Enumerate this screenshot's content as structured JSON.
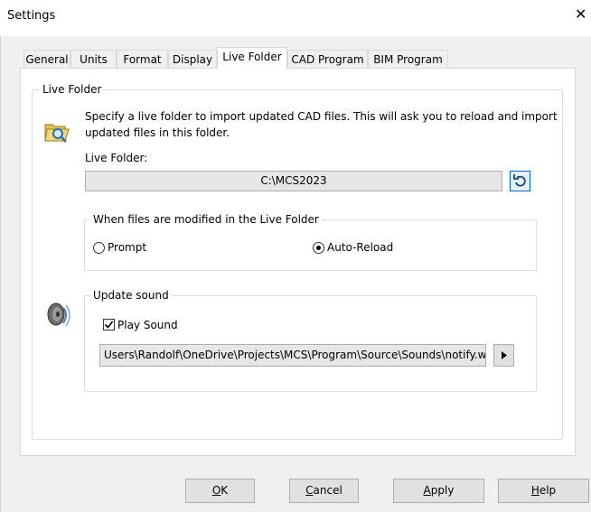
{
  "window": {
    "title": "Settings",
    "close_glyph": "✕"
  },
  "tabs": [
    {
      "label": "General"
    },
    {
      "label": "Units"
    },
    {
      "label": "Format"
    },
    {
      "label": "Display"
    },
    {
      "label": "Live Folder"
    },
    {
      "label": "CAD Program"
    },
    {
      "label": "BIM Program"
    }
  ],
  "active_tab": "Live Folder",
  "live_folder": {
    "group_label": "Live Folder",
    "icon": "folder-search-icon",
    "description_line1": "Specify a live folder to import updated CAD files. This will ask you to reload and import",
    "description_line2": "updated files in this folder.",
    "field_label": "Live Folder:",
    "value": "C:\\MCS2023",
    "reset_button_icon": "undo-icon"
  },
  "modified_group": {
    "label": "When files are modified in the Live Folder",
    "options": [
      {
        "label": "Prompt",
        "selected": false
      },
      {
        "label": "Auto-Reload",
        "selected": true
      }
    ]
  },
  "sound": {
    "icon": "speaker-icon",
    "group_label": "Update sound",
    "play_sound_label": "Play Sound",
    "play_sound_checked": true,
    "path": "Users\\Randolf\\OneDrive\\Projects\\MCS\\Program\\Source\\Sounds\\notify.wav",
    "play_button_icon": "play-icon"
  },
  "buttons": {
    "ok": {
      "mnemonic": "O",
      "rest": "K"
    },
    "cancel": {
      "mnemonic": "C",
      "rest": "ancel"
    },
    "apply": {
      "mnemonic": "A",
      "rest": "pply"
    },
    "help": {
      "mnemonic": "H",
      "rest": "elp"
    }
  },
  "colors": {
    "selected_button_border": "#0a64d8",
    "folder_icon": "#e8c25a",
    "field_background": "#e6e6e6"
  }
}
